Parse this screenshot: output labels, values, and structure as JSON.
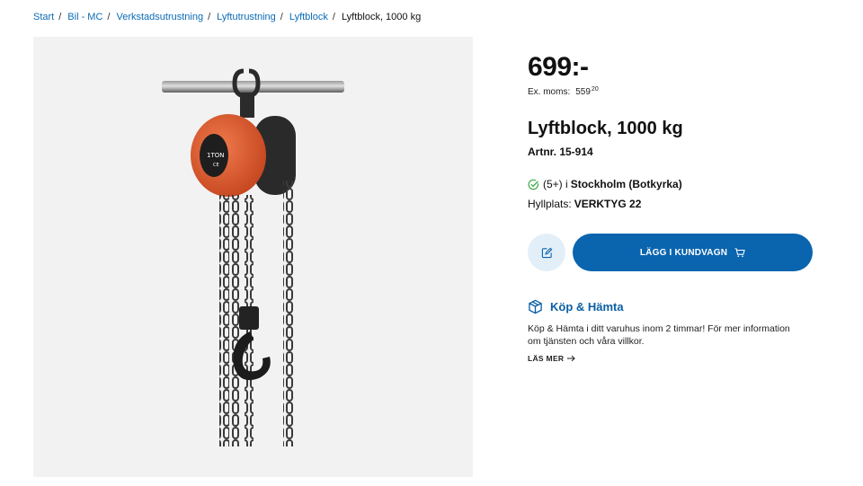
{
  "breadcrumb": {
    "items": [
      "Start",
      "Bil - MC",
      "Verkstadsutrustning",
      "Lyftutrustning",
      "Lyftblock"
    ],
    "current": "Lyftblock, 1000 kg",
    "separator": "/"
  },
  "product": {
    "price": "699:-",
    "ex_moms_label": "Ex. moms:",
    "ex_moms_value": "559",
    "ex_moms_cents": "20",
    "title": "Lyftblock, 1000 kg",
    "artnr": "Artnr. 15-914",
    "image_icon": "chain-hoist-image",
    "image_hoist_label": "1TON",
    "image_hoist_mark": "CE"
  },
  "stock": {
    "icon": "check-circle-icon",
    "count": "(5+) i",
    "store": "Stockholm (Botkyrka)",
    "shelf_label": "Hyllplats:",
    "shelf_value": "VERKTYG 22"
  },
  "actions": {
    "note_icon": "edit-icon",
    "add_to_cart_label": "LÄGG I KUNDVAGN",
    "cart_icon": "cart-icon"
  },
  "kop_hamta": {
    "icon": "box-icon",
    "title": "Köp & Hämta",
    "text": "Köp & Hämta i ditt varuhus inom 2 timmar! För mer information om tjänsten och våra villkor.",
    "link_label": "LÄS MER",
    "link_icon": "arrow-right-icon"
  },
  "colors": {
    "accent": "#0a64ae",
    "link": "#0b6bb5",
    "check": "#3aa845",
    "hoist_body": "#e15a2e"
  }
}
